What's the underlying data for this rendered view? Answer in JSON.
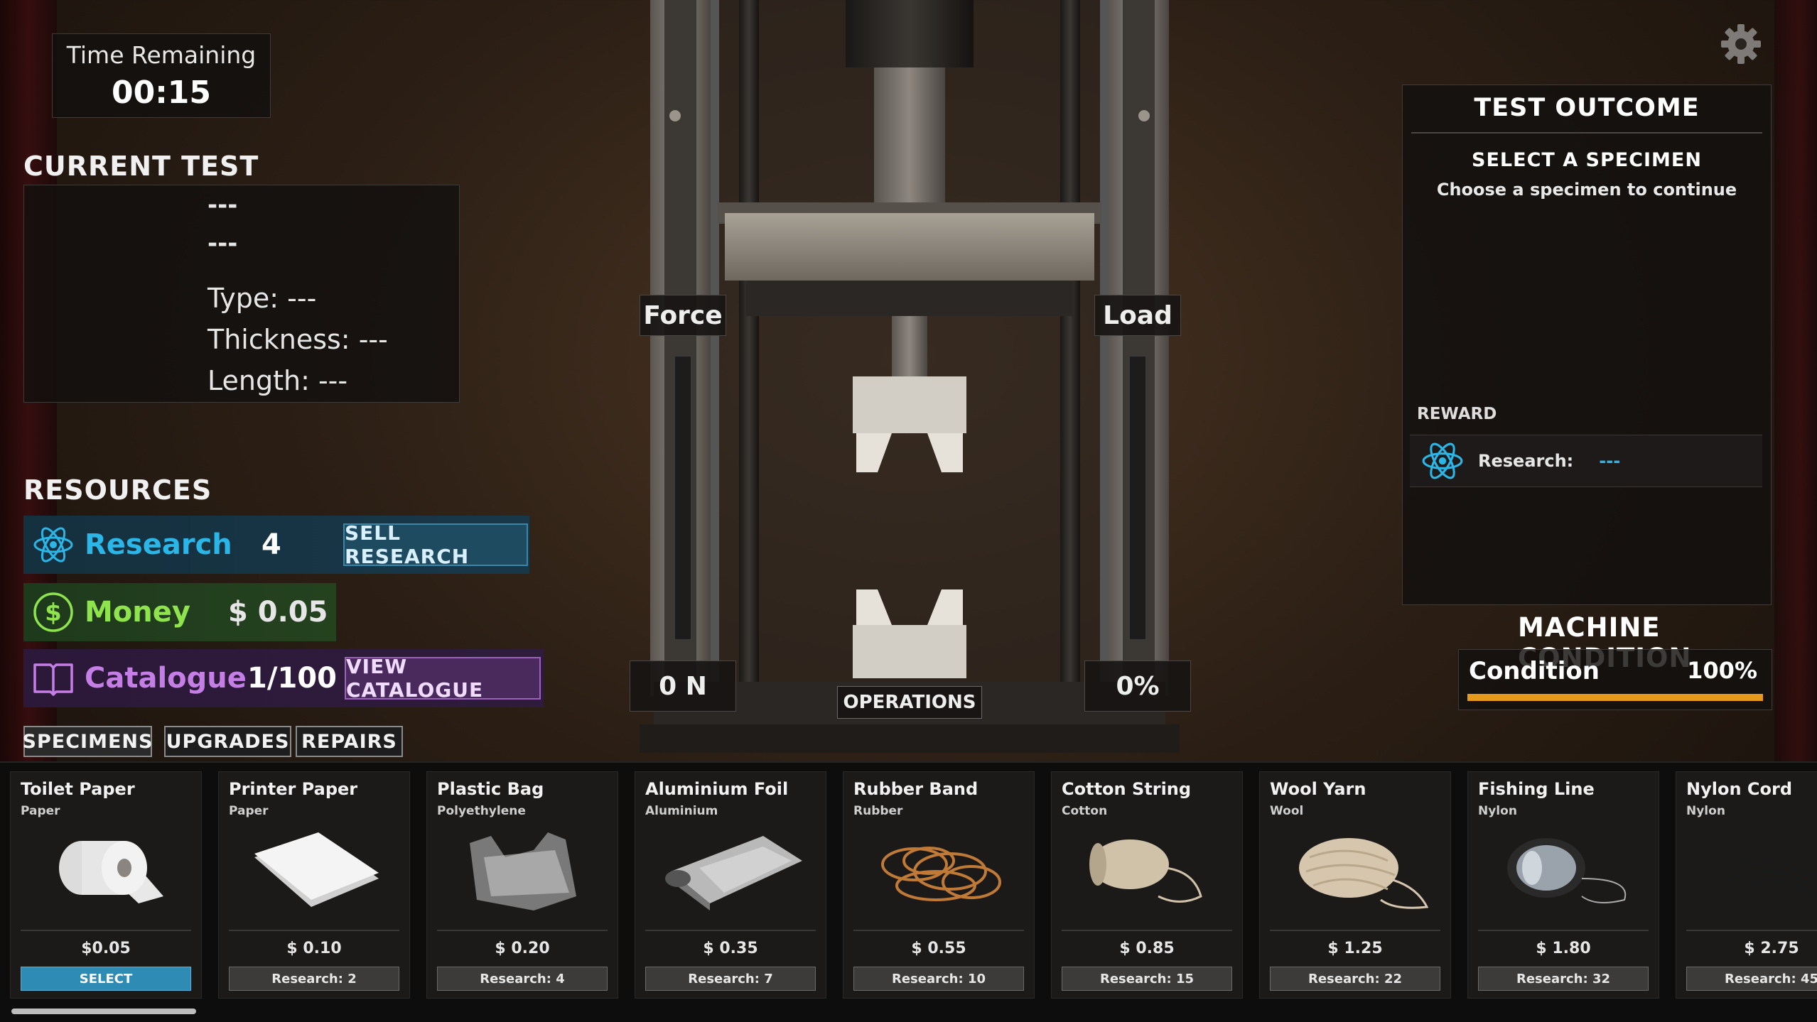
{
  "timer": {
    "label": "Time Remaining",
    "value": "00:15"
  },
  "current_test": {
    "title": "CURRENT TEST",
    "name": "---",
    "material": "---",
    "type": "Type: ---",
    "thickness": "Thickness: ---",
    "length": "Length: ---"
  },
  "resources": {
    "title": "RESOURCES",
    "research": {
      "label": "Research",
      "value": "4",
      "button": "SELL RESEARCH",
      "color": "#2bb6e8"
    },
    "money": {
      "label": "Money",
      "value": "$ 0.05",
      "color": "#8fe34d"
    },
    "catalogue": {
      "label": "Catalogue",
      "value": "1/100",
      "button": "VIEW CATALOGUE",
      "color": "#c57ee6"
    }
  },
  "tabs": [
    "SPECIMENS",
    "UPGRADES",
    "REPAIRS"
  ],
  "machine": {
    "force_label": "Force",
    "load_label": "Load",
    "force_value": "0 N",
    "load_value": "0%",
    "operations_button": "OPERATIONS"
  },
  "outcome": {
    "title": "TEST OUTCOME",
    "subtitle": "SELECT A SPECIMEN",
    "description": "Choose a specimen to continue",
    "reward_label": "REWARD",
    "reward_research_label": "Research:",
    "reward_research_value": "---"
  },
  "machine_condition": {
    "title": "MACHINE CONDITION",
    "label": "Condition",
    "value": "100%",
    "level": 1.0,
    "bar_color": "#e59a1c"
  },
  "specimens": [
    {
      "name": "Toilet Paper",
      "material": "Paper",
      "price": "$0.05",
      "button": "SELECT",
      "selectable": true,
      "icon": "toilet-paper"
    },
    {
      "name": "Printer  Paper",
      "material": "Paper",
      "price": "$ 0.10",
      "button": "Research: 2",
      "selectable": false,
      "icon": "printer-paper"
    },
    {
      "name": "Plastic Bag",
      "material": "Polyethylene",
      "price": "$ 0.20",
      "button": "Research: 4",
      "selectable": false,
      "icon": "plastic-bag"
    },
    {
      "name": "Aluminium Foil",
      "material": "Aluminium",
      "price": "$ 0.35",
      "button": "Research: 7",
      "selectable": false,
      "icon": "aluminium-foil"
    },
    {
      "name": "Rubber Band",
      "material": "Rubber",
      "price": "$ 0.55",
      "button": "Research: 10",
      "selectable": false,
      "icon": "rubber-bands"
    },
    {
      "name": "Cotton String",
      "material": "Cotton",
      "price": "$ 0.85",
      "button": "Research: 15",
      "selectable": false,
      "icon": "cotton-string"
    },
    {
      "name": "Wool Yarn",
      "material": "Wool",
      "price": "$ 1.25",
      "button": "Research: 22",
      "selectable": false,
      "icon": "wool-yarn"
    },
    {
      "name": "Fishing Line",
      "material": "Nylon",
      "price": "$ 1.80",
      "button": "Research: 32",
      "selectable": false,
      "icon": "fishing-line"
    },
    {
      "name": "Nylon Cord",
      "material": "Nylon",
      "price": "$ 2.75",
      "button": "Research: 45",
      "selectable": false,
      "icon": "nylon-cord"
    }
  ]
}
